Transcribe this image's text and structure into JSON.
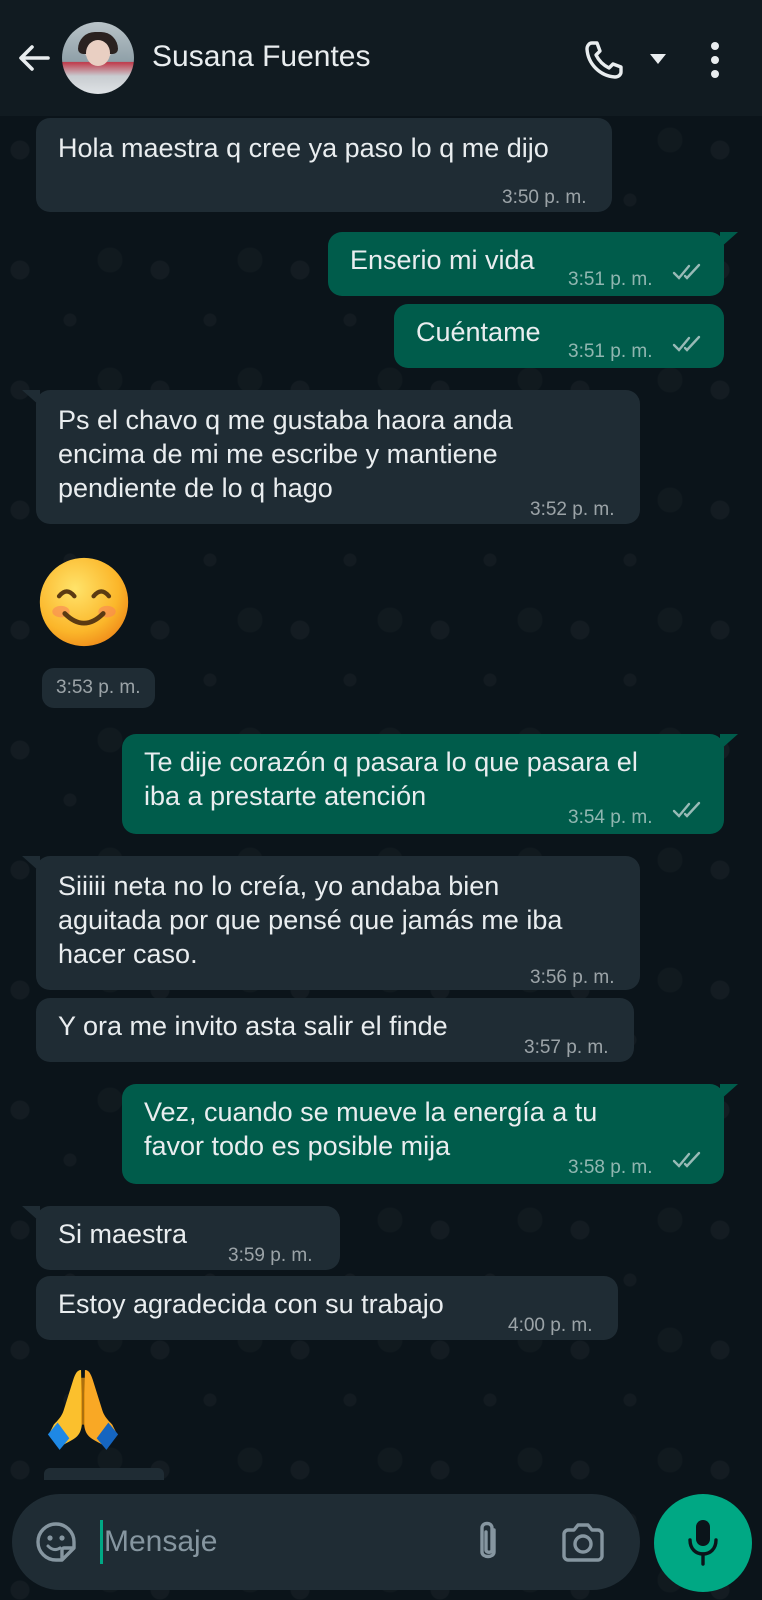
{
  "header": {
    "contact_name": "Susana Fuentes"
  },
  "messages": [
    {
      "direction": "in",
      "text": [
        "Hola maestra q cree ya paso lo q me dijo"
      ],
      "time": "3:50 p. m."
    },
    {
      "direction": "out",
      "text": [
        "Enserio mi vida"
      ],
      "time": "3:51 p. m.",
      "status": "read"
    },
    {
      "direction": "out",
      "text": [
        "Cuéntame"
      ],
      "time": "3:51 p. m.",
      "status": "read"
    },
    {
      "direction": "in",
      "text": [
        "Ps el chavo q me gustaba haora anda",
        "encima de mi me escribe y mantiene",
        "pendiente de lo q hago"
      ],
      "time": "3:52 p. m."
    },
    {
      "direction": "in",
      "emoji": "😊",
      "time": "3:53 p. m."
    },
    {
      "direction": "out",
      "text": [
        "Te dije corazón q pasara lo que pasara el",
        "iba a prestarte atención"
      ],
      "time": "3:54 p. m.",
      "status": "read"
    },
    {
      "direction": "in",
      "text": [
        "Siiiii neta no lo creía, yo andaba bien",
        "aguitada por que pensé que jamás me iba",
        "hacer caso."
      ],
      "time": "3:56 p. m."
    },
    {
      "direction": "in",
      "text": [
        "Y ora me invito asta salir el finde"
      ],
      "time": "3:57 p. m."
    },
    {
      "direction": "out",
      "text": [
        "Vez, cuando se mueve la energía a tu",
        "favor todo es posible mija"
      ],
      "time": "3:58 p. m.",
      "status": "read"
    },
    {
      "direction": "in",
      "text": [
        "Si maestra"
      ],
      "time": "3:59 p. m."
    },
    {
      "direction": "in",
      "text": [
        "Estoy agradecida con su trabajo"
      ],
      "time": "4:00 p. m."
    },
    {
      "direction": "in",
      "emoji": "🙏"
    }
  ],
  "composer": {
    "placeholder": "Mensaje"
  },
  "colors": {
    "background": "#0b141a",
    "header": "#111b21",
    "incoming_bubble": "#1f2c34",
    "outgoing_bubble": "#005c4b",
    "accent": "#00a884"
  },
  "icons": [
    "back-arrow-icon",
    "voice-call-icon",
    "dropdown-caret-icon",
    "more-options-icon",
    "sticker-icon",
    "attach-icon",
    "camera-icon",
    "microphone-icon",
    "read-double-check-icon"
  ]
}
